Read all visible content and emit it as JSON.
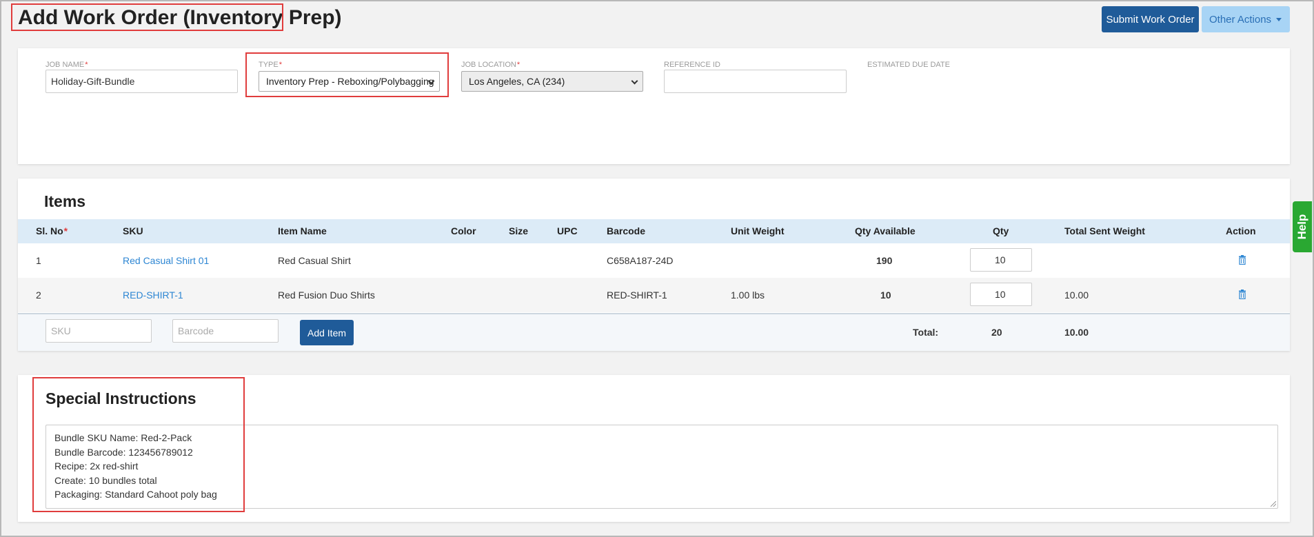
{
  "header": {
    "title": "Add Work Order (Inventory Prep)",
    "submit_label": "Submit Work Order",
    "other_actions_label": "Other Actions"
  },
  "job": {
    "name_label": "JOB NAME",
    "name_value": "Holiday-Gift-Bundle",
    "type_label": "TYPE",
    "type_value": "Inventory Prep - Reboxing/Polybagging",
    "location_label": "JOB LOCATION",
    "location_value": "Los Angeles, CA (234)",
    "reference_label": "REFERENCE ID",
    "reference_value": "",
    "due_label": "ESTIMATED DUE DATE"
  },
  "items": {
    "title": "Items",
    "columns": [
      "Sl. No",
      "SKU",
      "Item Name",
      "Color",
      "Size",
      "UPC",
      "Barcode",
      "Unit Weight",
      "Qty Available",
      "Qty",
      "Total Sent Weight",
      "Action"
    ],
    "rows": [
      {
        "sl": "1",
        "sku": "Red Casual Shirt 01",
        "name": "Red Casual Shirt",
        "color": "",
        "size": "",
        "upc": "",
        "barcode": "C658A187-24D",
        "unit_weight": "",
        "qty_available": "190",
        "qty": "10",
        "total_weight": ""
      },
      {
        "sl": "2",
        "sku": "RED-SHIRT-1",
        "name": "Red Fusion Duo Shirts",
        "color": "",
        "size": "",
        "upc": "",
        "barcode": "RED-SHIRT-1",
        "unit_weight": "1.00 lbs",
        "qty_available": "10",
        "qty": "10",
        "total_weight": "10.00"
      }
    ],
    "sku_placeholder": "SKU",
    "barcode_placeholder": "Barcode",
    "add_label": "Add Item",
    "total_label": "Total:",
    "total_qty": "20",
    "total_weight": "10.00"
  },
  "special": {
    "title": "Special Instructions",
    "lines": [
      "Bundle SKU Name: Red-2-Pack",
      "Bundle Barcode: 123456789012",
      "Recipe: 2x red-shirt",
      "Create: 10 bundles total",
      "Packaging: Standard Cahoot poly bag"
    ]
  },
  "help": {
    "label": "Help"
  },
  "colors": {
    "primary": "#1f5b99",
    "link": "#2d86d3",
    "highlight": "#e03c3c",
    "help": "#2aa832"
  }
}
